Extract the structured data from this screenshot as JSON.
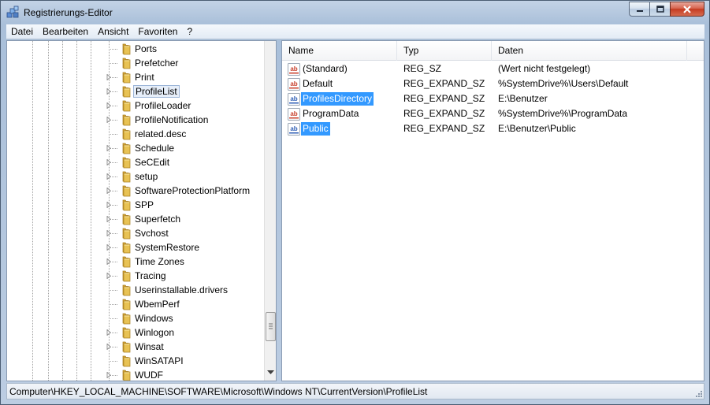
{
  "window": {
    "title": "Registrierungs-Editor"
  },
  "menu": [
    "Datei",
    "Bearbeiten",
    "Ansicht",
    "Favoriten",
    "?"
  ],
  "tree": {
    "items": [
      {
        "label": "Ports",
        "expandable": false
      },
      {
        "label": "Prefetcher",
        "expandable": false
      },
      {
        "label": "Print",
        "expandable": true
      },
      {
        "label": "ProfileList",
        "expandable": true,
        "selected": true
      },
      {
        "label": "ProfileLoader",
        "expandable": true
      },
      {
        "label": "ProfileNotification",
        "expandable": true
      },
      {
        "label": "related.desc",
        "expandable": false
      },
      {
        "label": "Schedule",
        "expandable": true
      },
      {
        "label": "SeCEdit",
        "expandable": true
      },
      {
        "label": "setup",
        "expandable": true
      },
      {
        "label": "SoftwareProtectionPlatform",
        "expandable": true
      },
      {
        "label": "SPP",
        "expandable": true
      },
      {
        "label": "Superfetch",
        "expandable": true
      },
      {
        "label": "Svchost",
        "expandable": true
      },
      {
        "label": "SystemRestore",
        "expandable": true
      },
      {
        "label": "Time Zones",
        "expandable": true
      },
      {
        "label": "Tracing",
        "expandable": true
      },
      {
        "label": "Userinstallable.drivers",
        "expandable": false
      },
      {
        "label": "WbemPerf",
        "expandable": false
      },
      {
        "label": "Windows",
        "expandable": false
      },
      {
        "label": "Winlogon",
        "expandable": true
      },
      {
        "label": "Winsat",
        "expandable": true
      },
      {
        "label": "WinSATAPI",
        "expandable": false
      },
      {
        "label": "WUDF",
        "expandable": true
      }
    ]
  },
  "list": {
    "columns": {
      "name": "Name",
      "typ": "Typ",
      "daten": "Daten"
    },
    "rows": [
      {
        "name": "(Standard)",
        "typ": "REG_SZ",
        "daten": "(Wert nicht festgelegt)",
        "highlight": false
      },
      {
        "name": "Default",
        "typ": "REG_EXPAND_SZ",
        "daten": "%SystemDrive%\\Users\\Default",
        "highlight": false
      },
      {
        "name": "ProfilesDirectory",
        "typ": "REG_EXPAND_SZ",
        "daten": "E:\\Benutzer",
        "highlight": true
      },
      {
        "name": "ProgramData",
        "typ": "REG_EXPAND_SZ",
        "daten": "%SystemDrive%\\ProgramData",
        "highlight": false
      },
      {
        "name": "Public",
        "typ": "REG_EXPAND_SZ",
        "daten": "E:\\Benutzer\\Public",
        "highlight": true
      }
    ]
  },
  "statusbar": {
    "path": "Computer\\HKEY_LOCAL_MACHINE\\SOFTWARE\\Microsoft\\Windows NT\\CurrentVersion\\ProfileList"
  },
  "colors": {
    "selection": "#3399ff",
    "folder": "#e8c254",
    "string-icon-red": "#c8402c",
    "string-icon-blue": "#2f5fb5"
  }
}
